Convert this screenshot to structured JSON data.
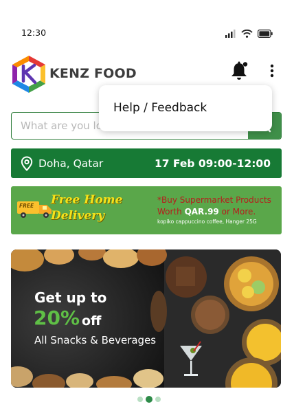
{
  "status_bar": {
    "time": "12:30",
    "icons": [
      "signal-icon",
      "wifi-icon",
      "battery-icon"
    ]
  },
  "header": {
    "brand": "KENZ FOOD",
    "icons": [
      "logo-icon",
      "notification-bell-icon",
      "more-options-icon"
    ]
  },
  "menu": {
    "items": [
      {
        "label": "Help / Feedback"
      }
    ]
  },
  "search": {
    "placeholder": "What are you looking for?",
    "icon": "search-icon"
  },
  "location": {
    "place": "Doha, Qatar",
    "slot": "17 Feb 09:00-12:00",
    "icon": "location-pin-icon"
  },
  "promo": {
    "badge": "FREE",
    "headline": "Free Home Delivery",
    "offer_text": "*Buy Supermarket Products",
    "offer_prefix": "Worth ",
    "offer_amount": "QAR.99",
    "offer_suffix": " or More.",
    "fine_print": "kopiko cappuccino coffee, Hanger 25G",
    "icon": "delivery-truck-icon"
  },
  "banner": {
    "line1": "Get up to",
    "percent": "20%",
    "off": "off",
    "subtitle": "All Snacks & Beverages"
  },
  "carousel": {
    "total": 3,
    "active_index": 1
  },
  "colors": {
    "primary_green": "#177a35",
    "promo_green": "#5aa74a",
    "accent_yellow": "#f5e21a",
    "offer_red": "#b71c1c"
  }
}
